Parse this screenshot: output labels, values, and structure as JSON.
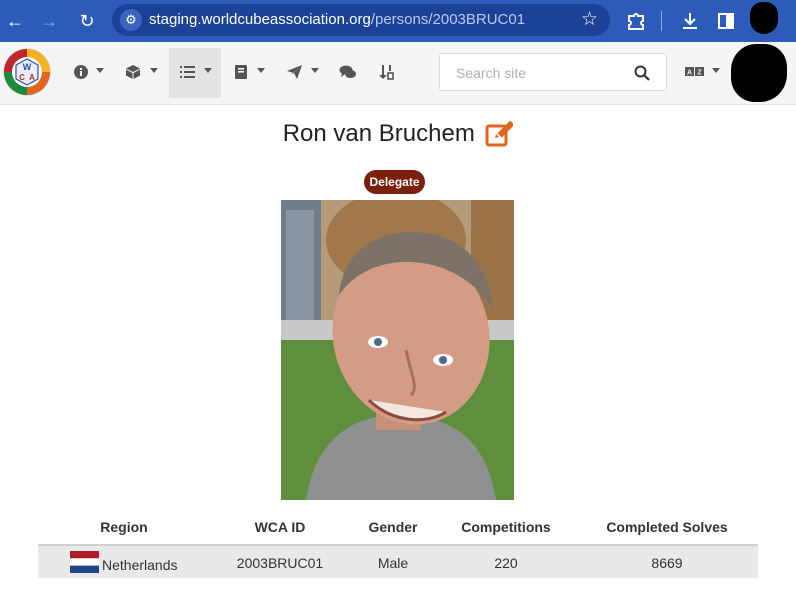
{
  "browser": {
    "url_host": "staging.worldcubeassociation.org",
    "url_path": "/persons/2003BRUC01"
  },
  "site": {
    "search_placeholder": "Search site"
  },
  "person": {
    "name": "Ron van Bruchem",
    "badge": "Delegate"
  },
  "table": {
    "headers": {
      "region": "Region",
      "wca_id": "WCA ID",
      "gender": "Gender",
      "competitions": "Competitions",
      "completed_solves": "Completed Solves"
    },
    "row": {
      "region": "Netherlands",
      "wca_id": "2003BRUC01",
      "gender": "Male",
      "competitions": "220",
      "completed_solves": "8669"
    }
  },
  "icons": {
    "back": "arrow-left-icon",
    "forward": "arrow-right-icon",
    "reload": "reload-icon",
    "bookmark": "star-icon",
    "edit": "edit-icon",
    "search": "search-icon"
  },
  "colors": {
    "chrome_blue": "#2d5bb9",
    "badge": "#7a200c",
    "edit_icon": "#e0661d"
  }
}
